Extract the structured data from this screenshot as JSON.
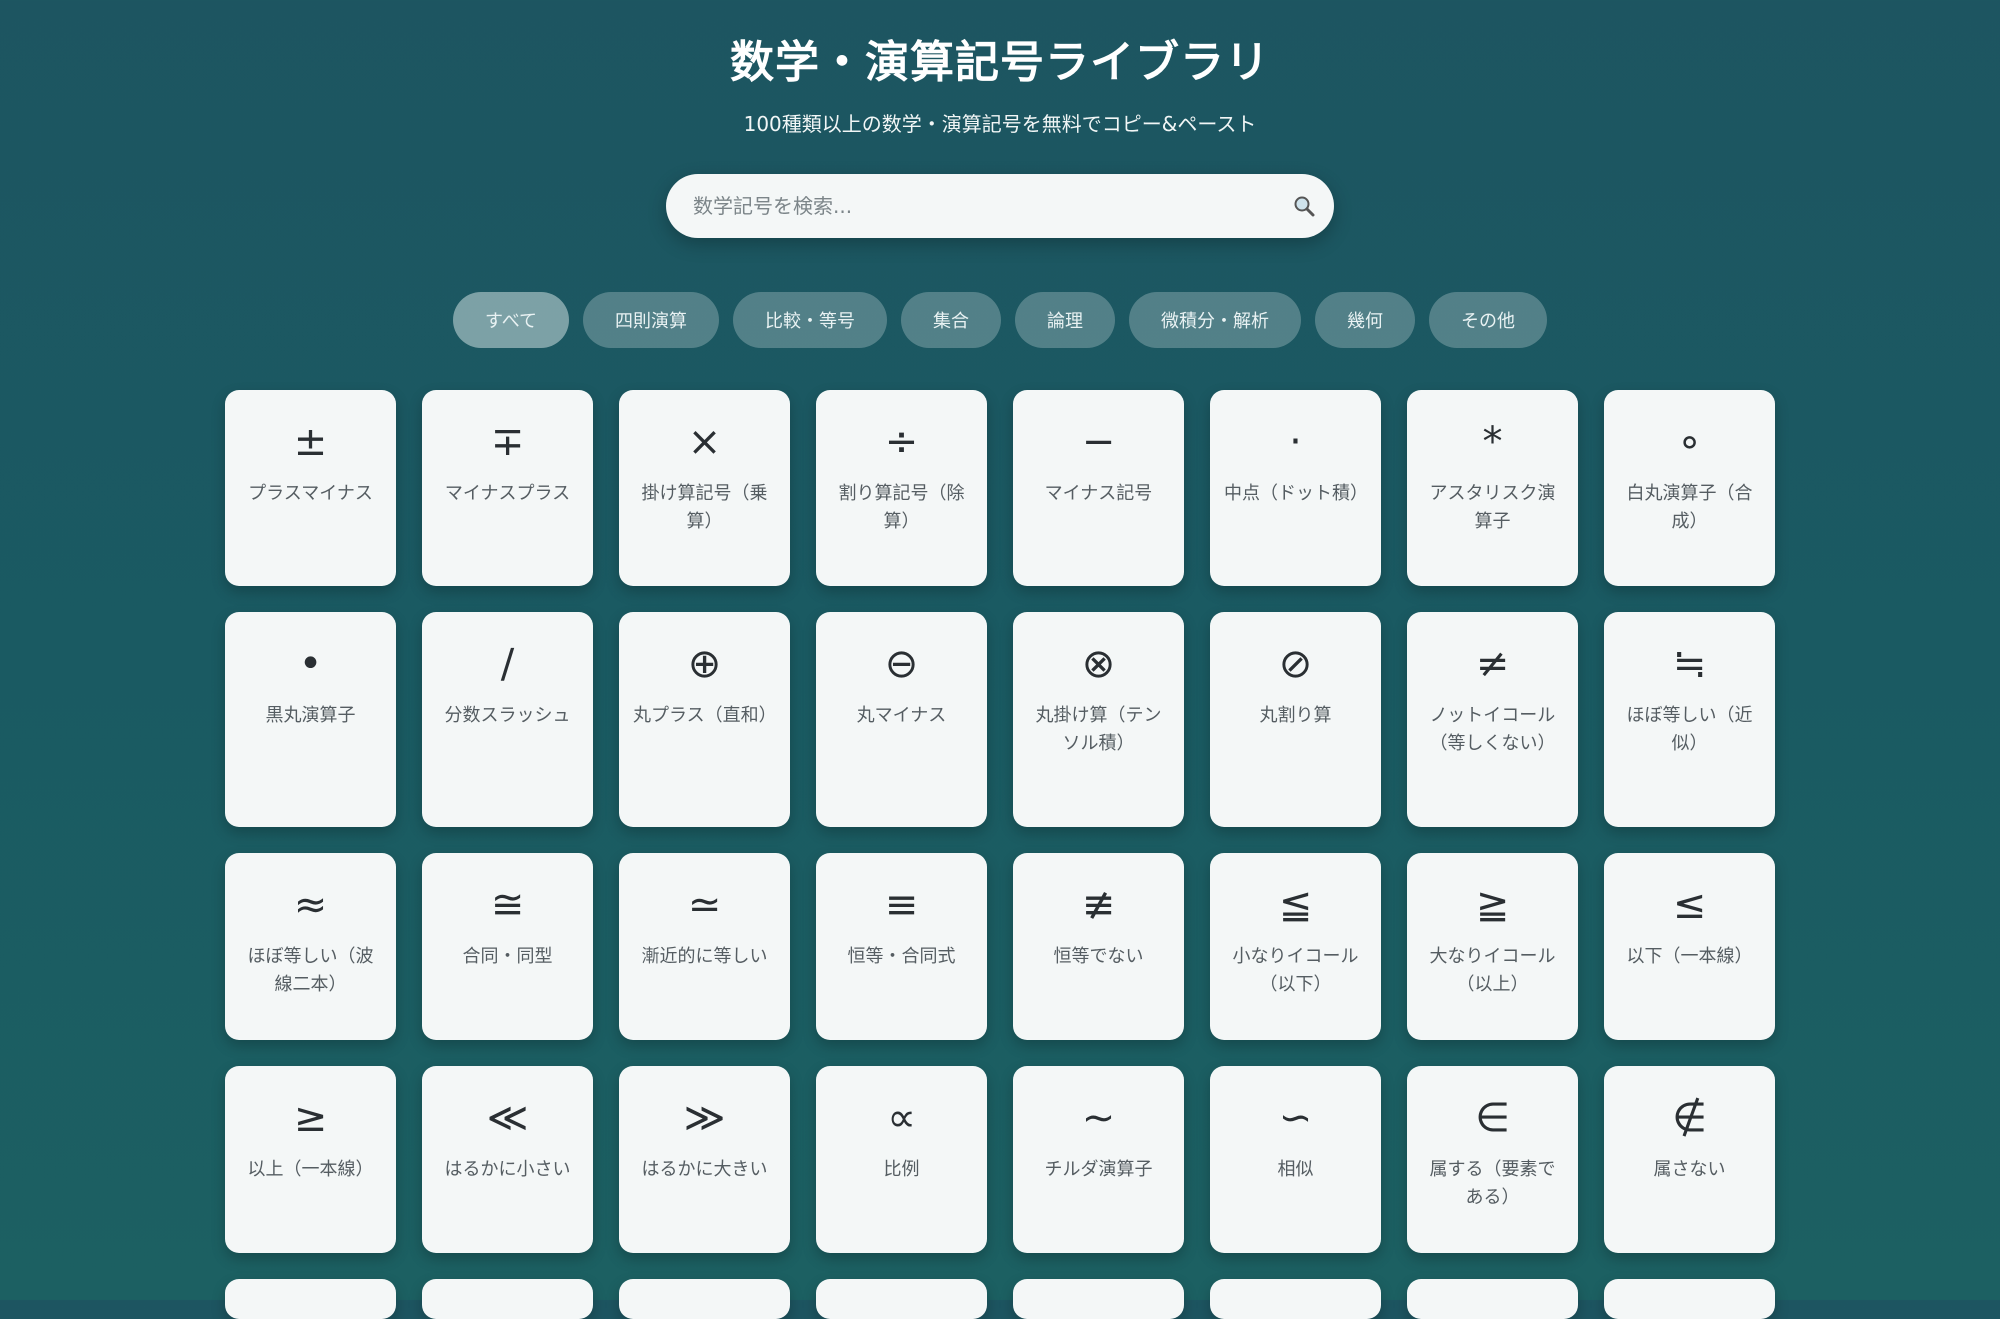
{
  "header": {
    "title": "数学・演算記号ライブラリ",
    "subtitle": "100種類以上の数学・演算記号を無料でコピー&ペースト"
  },
  "search": {
    "placeholder": "数学記号を検索...",
    "icon": "search-icon"
  },
  "filters": [
    {
      "label": "すべて",
      "active": true
    },
    {
      "label": "四則演算",
      "active": false
    },
    {
      "label": "比較・等号",
      "active": false
    },
    {
      "label": "集合",
      "active": false
    },
    {
      "label": "論理",
      "active": false
    },
    {
      "label": "微積分・解析",
      "active": false
    },
    {
      "label": "幾何",
      "active": false
    },
    {
      "label": "その他",
      "active": false
    }
  ],
  "symbols": [
    {
      "symbol": "±",
      "name": "プラスマイナス"
    },
    {
      "symbol": "∓",
      "name": "マイナスプラス"
    },
    {
      "symbol": "×",
      "name": "掛け算記号（乗算）"
    },
    {
      "symbol": "÷",
      "name": "割り算記号（除算）"
    },
    {
      "symbol": "−",
      "name": "マイナス記号"
    },
    {
      "symbol": "·",
      "name": "中点（ドット積）"
    },
    {
      "symbol": "*",
      "name": "アスタリスク演算子"
    },
    {
      "symbol": "∘",
      "name": "白丸演算子（合成）"
    },
    {
      "symbol": "•",
      "name": "黒丸演算子"
    },
    {
      "symbol": "∕",
      "name": "分数スラッシュ"
    },
    {
      "symbol": "⊕",
      "name": "丸プラス（直和）"
    },
    {
      "symbol": "⊖",
      "name": "丸マイナス"
    },
    {
      "symbol": "⊗",
      "name": "丸掛け算（テンソル積）"
    },
    {
      "symbol": "⊘",
      "name": "丸割り算"
    },
    {
      "symbol": "≠",
      "name": "ノットイコール（等しくない）"
    },
    {
      "symbol": "≒",
      "name": "ほぼ等しい（近似）"
    },
    {
      "symbol": "≈",
      "name": "ほぼ等しい（波線二本）"
    },
    {
      "symbol": "≅",
      "name": "合同・同型"
    },
    {
      "symbol": "≃",
      "name": "漸近的に等しい"
    },
    {
      "symbol": "≡",
      "name": "恒等・合同式"
    },
    {
      "symbol": "≢",
      "name": "恒等でない"
    },
    {
      "symbol": "≦",
      "name": "小なりイコール（以下）"
    },
    {
      "symbol": "≧",
      "name": "大なりイコール（以上）"
    },
    {
      "symbol": "≤",
      "name": "以下（一本線）"
    },
    {
      "symbol": "≥",
      "name": "以上（一本線）"
    },
    {
      "symbol": "≪",
      "name": "はるかに小さい"
    },
    {
      "symbol": "≫",
      "name": "はるかに大きい"
    },
    {
      "symbol": "∝",
      "name": "比例"
    },
    {
      "symbol": "∼",
      "name": "チルダ演算子"
    },
    {
      "symbol": "∽",
      "name": "相似"
    },
    {
      "symbol": "∈",
      "name": "属する（要素である）"
    },
    {
      "symbol": "∉",
      "name": "属さない"
    }
  ]
}
